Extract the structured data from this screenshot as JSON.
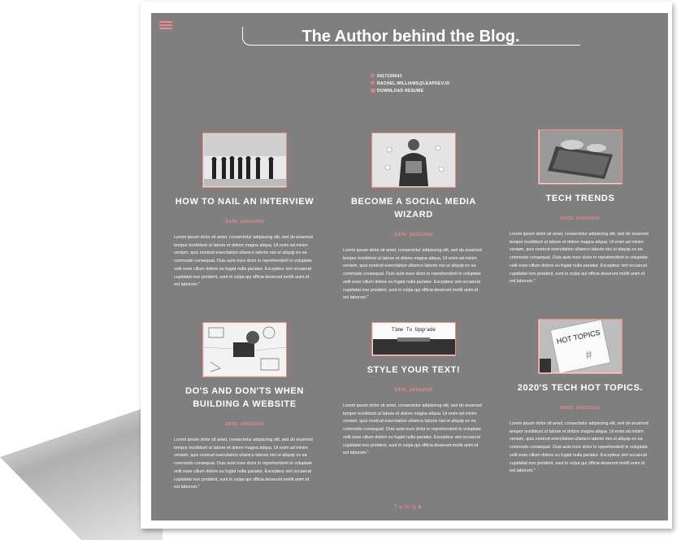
{
  "header": {
    "title": "The Author behind the Blog."
  },
  "contact": {
    "phone": "0417139641",
    "email": "RACHEL.WILLIAMS@LEAPDEV.IO",
    "resume": "DOWNLOAD RESUME"
  },
  "posts": [
    {
      "title": "HOW TO NAIL AN INTERVIEW",
      "date": "DATE: 24/03/2020",
      "image": "interview-photo",
      "body": "Lorem ipsum dolor sit amet, consectetur adipiscing elit, sed do eiusmod tempor incididunt ut labore et dolore magna aliqua. Ut enim ad minim veniam, quis nostrud exercitation ullamco laboris nisi ut aliquip ex ea commodo consequat. Duis aute irure dolor in reprehenderit in voluptate velit esse cillum dolore eu fugiat nulla pariatur. Excepteur sint occaecat cupidatat non proident, sunt in culpa qui officia deserunt mollit anim id est laborum.\""
    },
    {
      "title": "BECOME A SOCIAL MEDIA WIZARD",
      "date": "DATE: 24/03/2020",
      "image": "social-media-photo",
      "body": "Lorem ipsum dolor sit amet, consectetur adipiscing elit, sed do eiusmod tempor incididunt ut labore et dolore magna aliqua. Ut enim ad minim veniam, quis nostrud exercitation ullamco laboris nisi ut aliquip ex ea commodo consequat. Duis aute irure dolor in reprehenderit in voluptate velit esse cillum dolore eu fugiat nulla pariatur. Excepteur sint occaecat cupidatat non proident, sunt in culpa qui officia deserunt mollit anim id est laborum.\""
    },
    {
      "title": "TECH TRENDS",
      "date": "DATE: 24/03/2020",
      "image": "tech-trends-photo",
      "body": "Lorem ipsum dolor sit amet, consectetur adipiscing elit, sed do eiusmod tempor incididunt ut labore et dolore magna aliqua. Ut enim ad minim veniam, quis nostrud exercitation ullamco laboris nisi ut aliquip ex ea commodo consequat. Duis aute irure dolor in reprehenderit in voluptate velit esse cillum dolore eu fugiat nulla pariatur. Excepteur sint occaecat cupidatat non proident, sunt in culpa qui officia deserunt mollit anim id est laborum.\""
    },
    {
      "title": "DO'S AND DON'TS WHEN BUILDING A WEBSITE",
      "date": "DATE: 24/03/2020",
      "image": "web-design-photo",
      "body": "Lorem ipsum dolor sit amet, consectetur adipiscing elit, sed do eiusmod tempor incididunt ut labore et dolore magna aliqua. Ut enim ad minim veniam, quis nostrud exercitation ullamco laboris nisi ut aliquip ex ea commodo consequat. Duis aute irure dolor in reprehenderit in voluptate velit esse cillum dolore eu fugiat nulla pariatur. Excepteur sint occaecat cupidatat non proident, sunt in culpa qui officia deserunt mollit anim id est laborum.\""
    },
    {
      "title": "STYLE YOUR TEXT!",
      "date": "DATE: 24/03/2020",
      "image": "typewriter-photo",
      "image_text": "Time To Upgrade",
      "body": "Lorem ipsum dolor sit amet, consectetur adipiscing elit, sed do eiusmod tempor incididunt ut labore et dolore magna aliqua. Ut enim ad minim veniam, quis nostrud exercitation ullamco laboris nisi ut aliquip ex ea commodo consequat. Duis aute irure dolor in reprehenderit in voluptate velit esse cillum dolore eu fugiat nulla pariatur. Excepteur sint occaecat cupidatat non proident, sunt in culpa qui officia deserunt mollit anim id est laborum.\""
    },
    {
      "title": "2020'S TECH HOT TOPICS.",
      "date": "DATE: 24/03/2020",
      "image": "hot-topics-photo",
      "image_text": "HOT TOPICS",
      "body": "Lorem ipsum dolor sit amet, consectetur adipiscing elit, sed do eiusmod tempor incididunt ut labore et dolore magna aliqua. Ut enim ad minim veniam, quis nostrud exercitation ullamco laboris nisi ut aliquip ex ea commodo consequat. Duis aute irure dolor in reprehenderit in voluptate velit esse cillum dolore eu fugiat nulla pariatur. Excepteur sint occaecat cupidatat non proident, sunt in culpa qui officia deserunt mollit anim id est laborum.\""
    }
  ],
  "social": [
    "facebook-icon",
    "twitter-icon",
    "linkedin-icon",
    "instagram-icon",
    "github-icon"
  ],
  "colors": {
    "background": "#7f7f7f",
    "accent": "#f28b82",
    "text": "#ffffff"
  }
}
